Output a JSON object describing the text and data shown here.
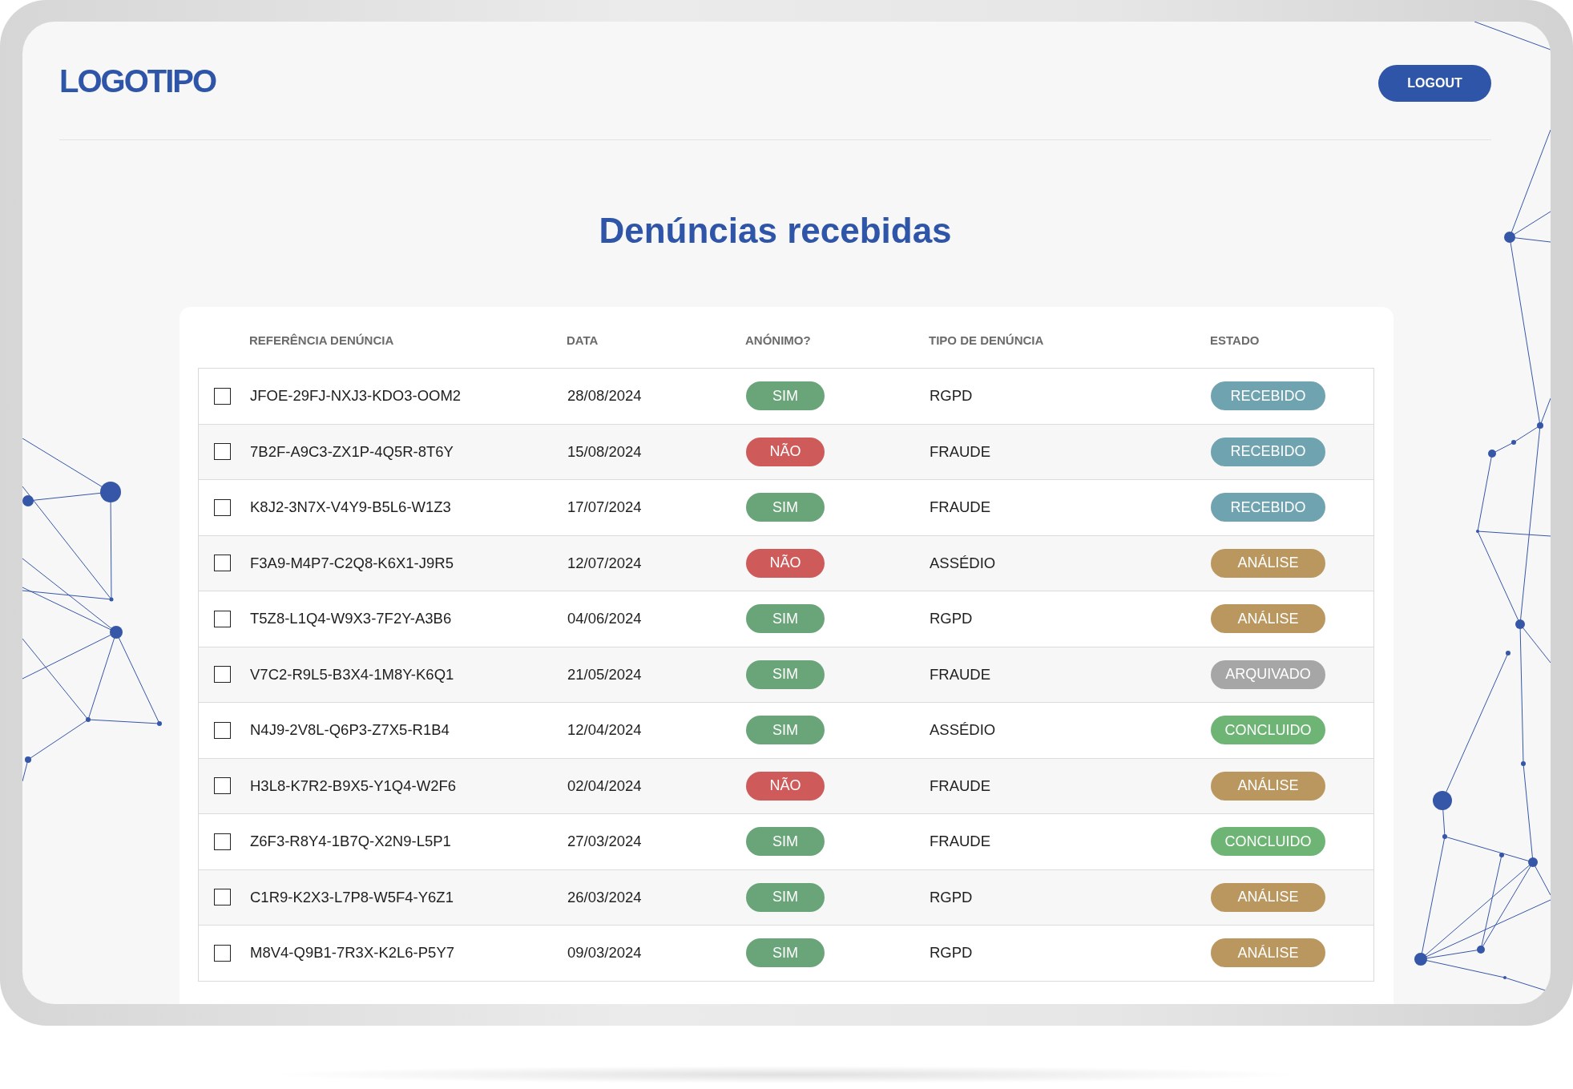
{
  "header": {
    "logo": "LOGOTIPO",
    "logout_button": "LOGOUT"
  },
  "title": "Denúncias recebidas",
  "table": {
    "columns": [
      "REFERÊNCIA DENÚNCIA",
      "DATA",
      "ANÓNIMO?",
      "TIPO DE DENÚNCIA",
      "ESTADO"
    ],
    "rows": [
      {
        "checked": false,
        "reference": "JFOE-29FJ-NXJ3-KDO3-OOM2",
        "date": "28/08/2024",
        "anonymous": {
          "label": "SIM",
          "color": "#6aa57a"
        },
        "type": "RGPD",
        "status": {
          "label": "RECEBIDO",
          "color": "#70a3b0"
        }
      },
      {
        "checked": false,
        "reference": "7B2F-A9C3-ZX1P-4Q5R-8T6Y",
        "date": "15/08/2024",
        "anonymous": {
          "label": "NÃO",
          "color": "#cf5a5a"
        },
        "type": "FRAUDE",
        "status": {
          "label": "RECEBIDO",
          "color": "#70a3b0"
        }
      },
      {
        "checked": false,
        "reference": "K8J2-3N7X-V4Y9-B5L6-W1Z3",
        "date": "17/07/2024",
        "anonymous": {
          "label": "SIM",
          "color": "#6aa57a"
        },
        "type": "FRAUDE",
        "status": {
          "label": "RECEBIDO",
          "color": "#70a3b0"
        }
      },
      {
        "checked": false,
        "reference": "F3A9-M4P7-C2Q8-K6X1-J9R5",
        "date": "12/07/2024",
        "anonymous": {
          "label": "NÃO",
          "color": "#cf5a5a"
        },
        "type": "ASSÉDIO",
        "status": {
          "label": "ANÁLISE",
          "color": "#ba975f"
        }
      },
      {
        "checked": false,
        "reference": "T5Z8-L1Q4-W9X3-7F2Y-A3B6",
        "date": "04/06/2024",
        "anonymous": {
          "label": "SIM",
          "color": "#6aa57a"
        },
        "type": "RGPD",
        "status": {
          "label": "ANÁLISE",
          "color": "#ba975f"
        }
      },
      {
        "checked": false,
        "reference": "V7C2-R9L5-B3X4-1M8Y-K6Q1",
        "date": "21/05/2024",
        "anonymous": {
          "label": "SIM",
          "color": "#6aa57a"
        },
        "type": "FRAUDE",
        "status": {
          "label": "ARQUIVADO",
          "color": "#a6a6a6"
        }
      },
      {
        "checked": false,
        "reference": "N4J9-2V8L-Q6P3-Z7X5-R1B4",
        "date": "12/04/2024",
        "anonymous": {
          "label": "SIM",
          "color": "#6aa57a"
        },
        "type": "ASSÉDIO",
        "status": {
          "label": "CONCLUIDO",
          "color": "#6db475"
        }
      },
      {
        "checked": false,
        "reference": "H3L8-K7R2-B9X5-Y1Q4-W2F6",
        "date": "02/04/2024",
        "anonymous": {
          "label": "NÃO",
          "color": "#cf5a5a"
        },
        "type": "FRAUDE",
        "status": {
          "label": "ANÁLISE",
          "color": "#ba975f"
        }
      },
      {
        "checked": false,
        "reference": "Z6F3-R8Y4-1B7Q-X2N9-L5P1",
        "date": "27/03/2024",
        "anonymous": {
          "label": "SIM",
          "color": "#6aa57a"
        },
        "type": "FRAUDE",
        "status": {
          "label": "CONCLUIDO",
          "color": "#6db475"
        }
      },
      {
        "checked": false,
        "reference": "C1R9-K2X3-L7P8-W5F4-Y6Z1",
        "date": "26/03/2024",
        "anonymous": {
          "label": "SIM",
          "color": "#6aa57a"
        },
        "type": "RGPD",
        "status": {
          "label": "ANÁLISE",
          "color": "#ba975f"
        }
      },
      {
        "checked": false,
        "reference": "M8V4-Q9B1-7R3X-K2L6-P5Y7",
        "date": "09/03/2024",
        "anonymous": {
          "label": "SIM",
          "color": "#6aa57a"
        },
        "type": "RGPD",
        "status": {
          "label": "ANÁLISE",
          "color": "#ba975f"
        }
      }
    ]
  }
}
